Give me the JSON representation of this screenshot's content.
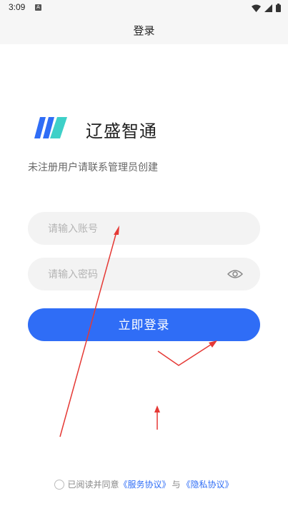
{
  "status_bar": {
    "time": "3:09",
    "notification_badge": "A",
    "icons": [
      "wifi-icon",
      "signal-icon",
      "battery-icon"
    ]
  },
  "header": {
    "title": "登录"
  },
  "brand": {
    "name": "辽盛智通",
    "logo_colors": [
      "#2f6df6",
      "#3ed0c8"
    ]
  },
  "notice": "未注册用户请联系管理员创建",
  "form": {
    "account_placeholder": "请输入账号",
    "password_placeholder": "请输入密码",
    "account_value": "",
    "password_value": ""
  },
  "login_button": "立即登录",
  "agreement": {
    "prefix": "已阅读并同意",
    "service_link": "《服务协议》",
    "joiner": "与",
    "privacy_link": "《隐私协议》"
  },
  "colors": {
    "accent": "#2f6df6",
    "annotation": "#e53935"
  }
}
